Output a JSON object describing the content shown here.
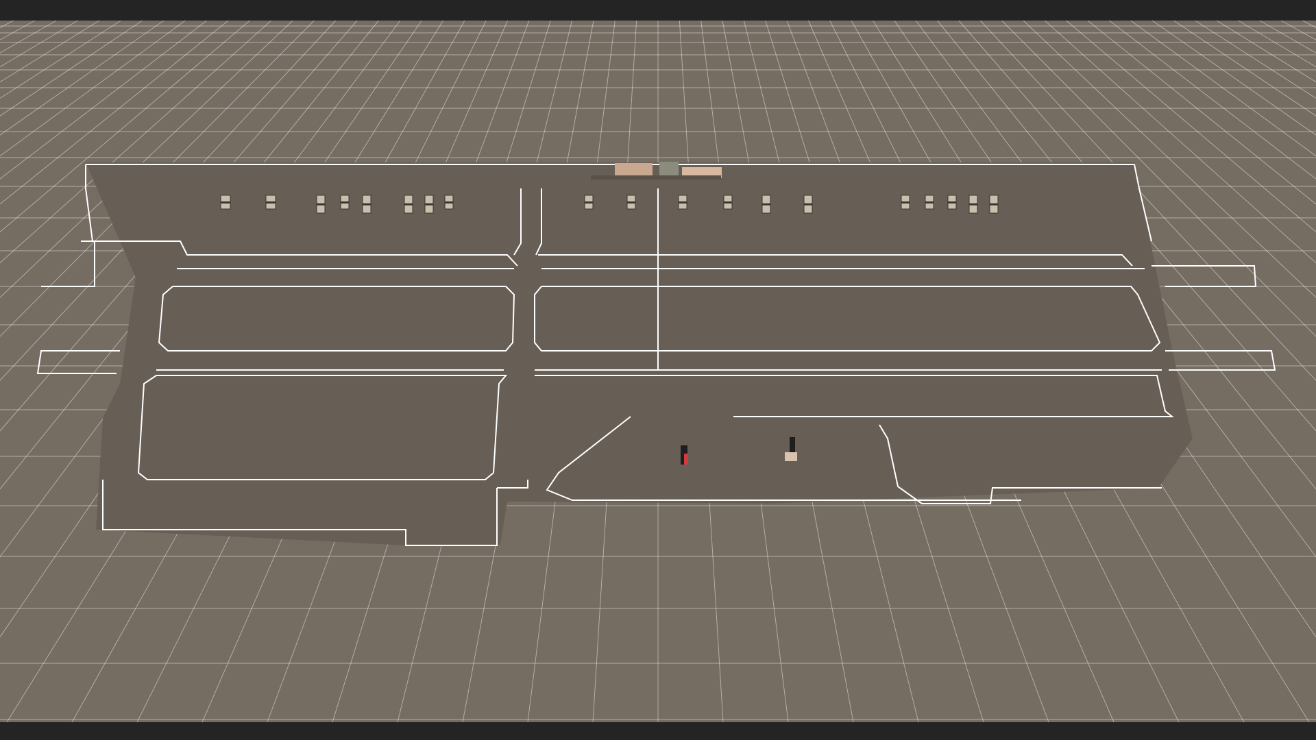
{
  "viewport": {
    "background_color": "#242424",
    "ground_color": "#756c62",
    "surface_color": "#675f56",
    "grid_line_color": "#ffffff",
    "outline_color": "#ffffff",
    "crate_fill_color": "#c9bfae",
    "crate_stripe_color": "#3a352f",
    "machine_colors": [
      "#c8a88f",
      "#8c8c7e",
      "#d8b8a0",
      "#5a524a"
    ],
    "marker_colors": [
      "#d23b3b",
      "#efe3d6",
      "#1e1e1e",
      "#d7c3ae"
    ]
  }
}
